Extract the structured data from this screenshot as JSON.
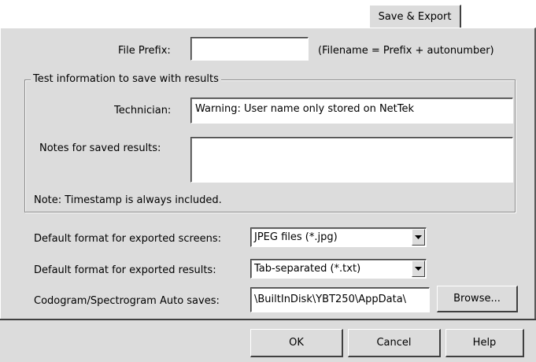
{
  "tab": {
    "label": "Save & Export"
  },
  "file_prefix": {
    "label": "File Prefix:",
    "value": "",
    "hint": "(Filename = Prefix + autonumber)"
  },
  "test_info": {
    "group_title": "Test information to save with results",
    "technician_label": "Technician:",
    "technician_value": "Warning: User name only stored on NetTek",
    "notes_label": "Notes for saved results:",
    "notes_value": "",
    "timestamp_note": "Note: Timestamp is always included."
  },
  "export": {
    "screens_label": "Default format for exported screens:",
    "screens_value": "JPEG files (*.jpg)",
    "results_label": "Default format for exported results:",
    "results_value": "Tab-separated (*.txt)",
    "autosave_label": "Codogram/Spectrogram Auto saves:",
    "autosave_value": "\\BuiltInDisk\\YBT250\\AppData\\",
    "browse_label": "Browse..."
  },
  "footer": {
    "ok_label": "OK",
    "cancel_label": "Cancel",
    "help_label": "Help"
  }
}
